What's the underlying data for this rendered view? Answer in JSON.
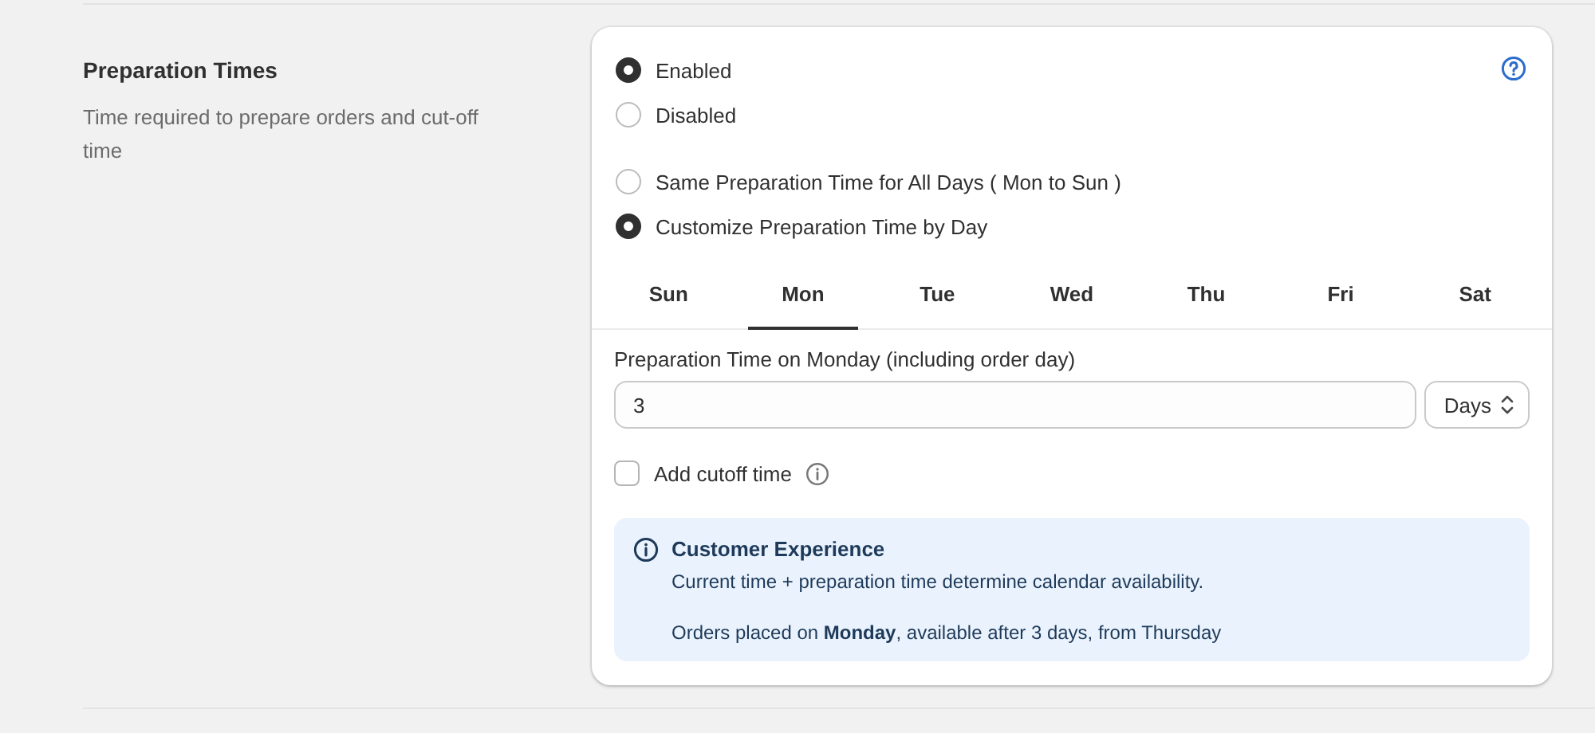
{
  "section": {
    "title": "Preparation Times",
    "description": "Time required to prepare orders and cut-off time"
  },
  "status_options": [
    {
      "label": "Enabled",
      "selected": true
    },
    {
      "label": "Disabled",
      "selected": false
    }
  ],
  "mode_options": [
    {
      "label": "Same Preparation Time for All Days ( Mon to Sun )",
      "selected": false
    },
    {
      "label": "Customize Preparation Time by Day",
      "selected": true
    }
  ],
  "day_tabs": [
    {
      "label": "Sun",
      "selected": false
    },
    {
      "label": "Mon",
      "selected": true
    },
    {
      "label": "Tue",
      "selected": false
    },
    {
      "label": "Wed",
      "selected": false
    },
    {
      "label": "Thu",
      "selected": false
    },
    {
      "label": "Fri",
      "selected": false
    },
    {
      "label": "Sat",
      "selected": false
    }
  ],
  "preparation_field": {
    "label": "Preparation Time on Monday (including order day)",
    "value": "3",
    "unit": "Days"
  },
  "cutoff_checkbox": {
    "label": "Add cutoff time",
    "checked": false
  },
  "info_banner": {
    "title": "Customer Experience",
    "lines": [
      "Current time + preparation time determine calendar availability.",
      "Orders placed on **Monday**, available after 3 days, from Thursday"
    ]
  }
}
